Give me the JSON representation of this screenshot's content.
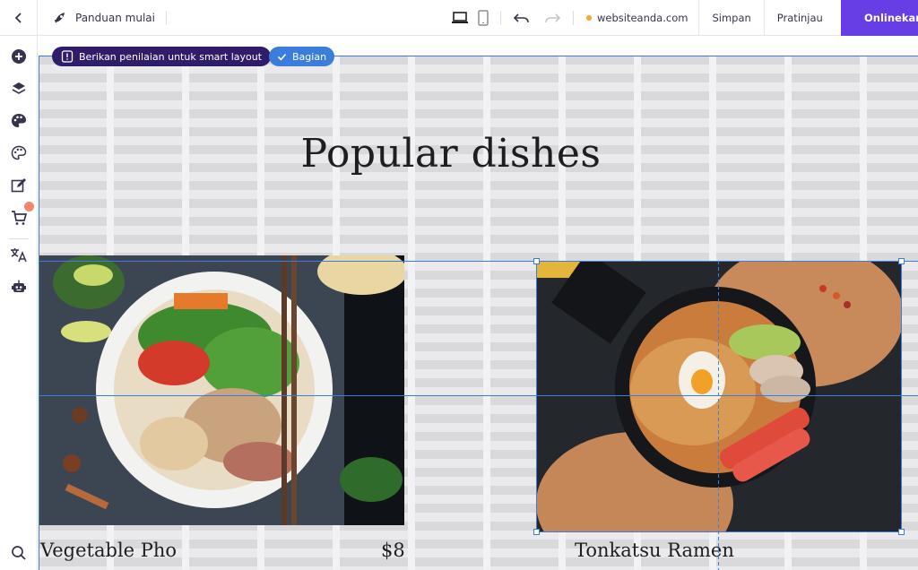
{
  "topbar": {
    "guide_label": "Panduan mulai",
    "domain": "websiteanda.com",
    "save_label": "Simpan",
    "preview_label": "Pratinjau",
    "publish_label": "Onlinekan"
  },
  "toolbar_pills": {
    "ai_label": "Berikan penilaian untuk smart layout",
    "section_label": "Bagian"
  },
  "section": {
    "heading": "Popular dishes",
    "items": [
      {
        "name": "Vegetable Pho",
        "price": "$8"
      },
      {
        "name": "Tonkatsu Ramen",
        "price": ""
      }
    ]
  },
  "colors": {
    "accent": "#673de6",
    "selection": "#3b7ddd",
    "pill_dark": "#2f1c6a"
  }
}
